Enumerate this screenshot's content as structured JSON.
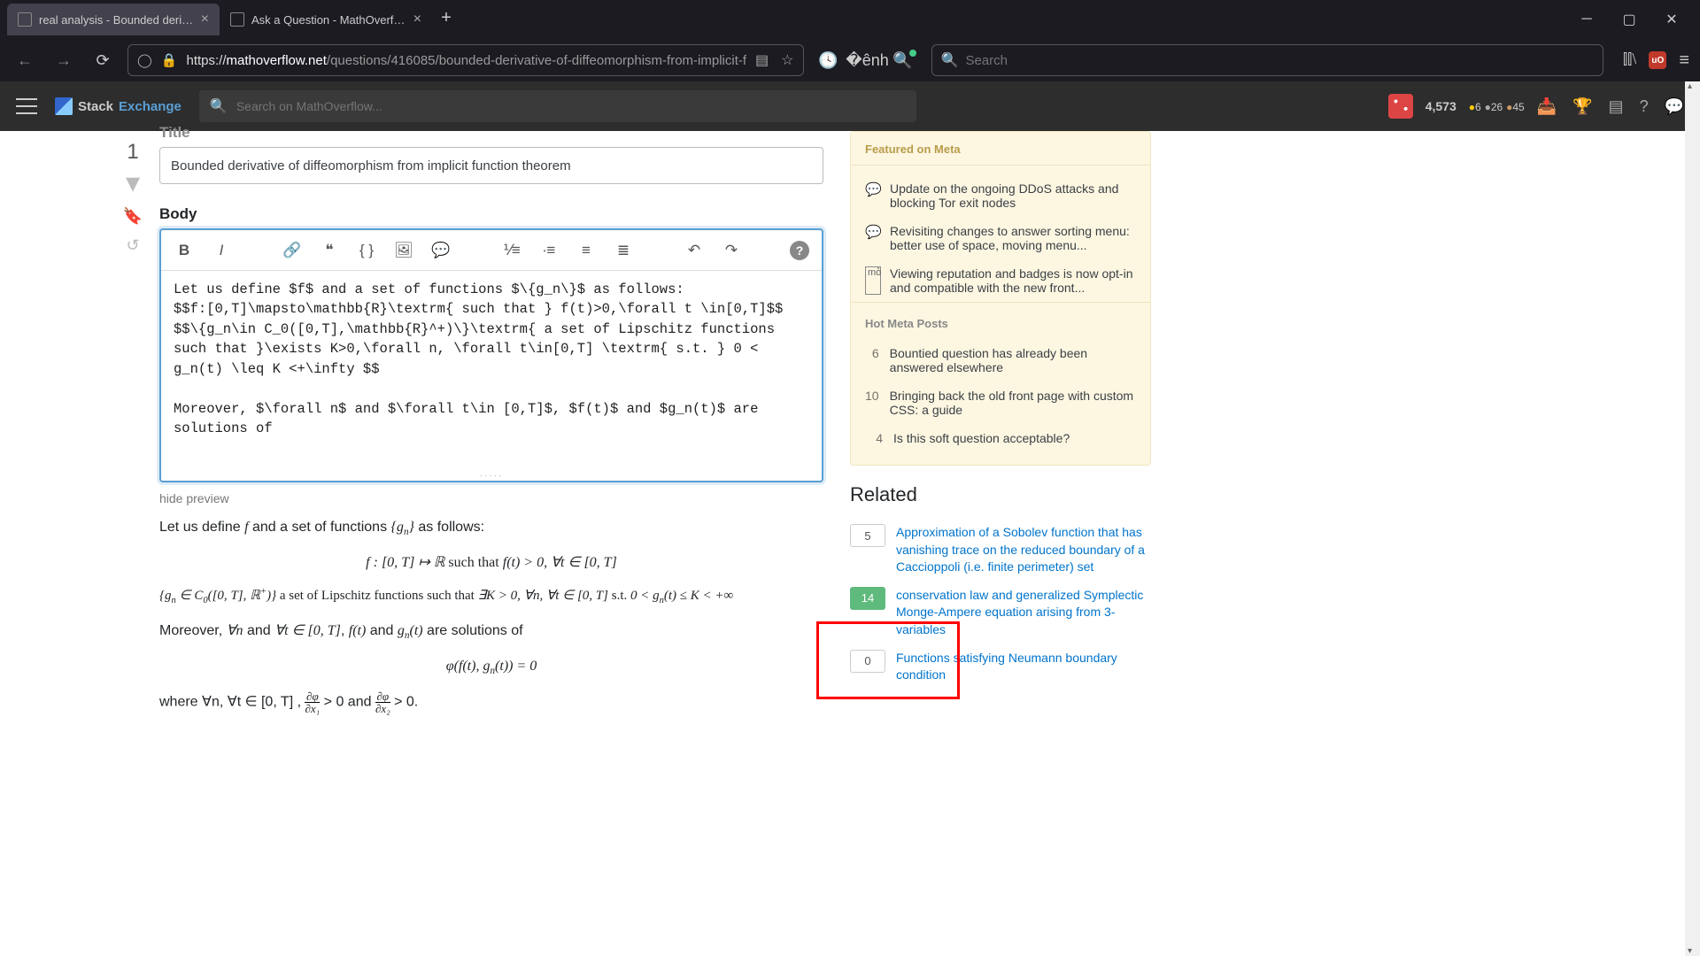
{
  "browser": {
    "tabs": [
      {
        "title": "real analysis - Bounded derivati",
        "active": true
      },
      {
        "title": "Ask a Question - MathOverflow",
        "active": false
      }
    ],
    "url_prefix": "https://",
    "url_domain": "mathoverflow.net",
    "url_path": "/questions/416085/bounded-derivative-of-diffeomorphism-from-implicit-f",
    "search_placeholder": "Search"
  },
  "topbar": {
    "logo_stack": "Stack",
    "logo_exchange": "Exchange",
    "search_placeholder": "Search on MathOverflow...",
    "rep": "4,573",
    "gold": "6",
    "silver": "26",
    "bronze": "45"
  },
  "editor": {
    "title_label": "Title",
    "title_value": "Bounded derivative of diffeomorphism from implicit function theorem",
    "body_label": "Body",
    "body_text": "Let us define $f$ and a set of functions $\\{g_n\\}$ as follows:\n$$f:[0,T]\\mapsto\\mathbb{R}\\textrm{ such that } f(t)>0,\\forall t \\in[0,T]$$\n$$\\{g_n\\in C_0([0,T],\\mathbb{R}^+)\\}\\textrm{ a set of Lipschitz functions such that }\\exists K>0,\\forall n, \\forall t\\in[0,T] \\textrm{ s.t. } 0 < g_n(t) \\leq K <+\\infty $$\n\nMoreover, $\\forall n$ and $\\forall t\\in [0,T]$, $f(t)$ and $g_n(t)$ are solutions of",
    "hide_preview": "hide preview",
    "grip": "·····"
  },
  "vote": {
    "score": "1"
  },
  "preview": {
    "p1_a": "Let us define ",
    "p1_b": " and a set of functions ",
    "p1_c": " as follows:",
    "disp1": "f : [0, T] ↦ ℝ such that f(t) > 0, ∀t ∈ [0, T]",
    "disp2": "{gₙ ∈ C₀([0, T], ℝ⁺)} a set of Lipschitz functions such that ∃K > 0, ∀n, ∀t ∈ [0, T] s.t. 0 < gₙ(t) ≤ K < +∞",
    "p2": "Moreover, ∀n and ∀t ∈ [0, T], f(t) and gₙ(t) are solutions of",
    "disp3": "φ(f(t), gₙ(t)) = 0",
    "p3_a": "where ∀n, ∀t ∈ [0, T] , ",
    "p3_frac1_top": "∂φ",
    "p3_frac1_bot": "∂x₁",
    "p3_mid": " > 0 and ",
    "p3_frac2_top": "∂φ",
    "p3_frac2_bot": "∂x₂",
    "p3_end": " > 0."
  },
  "meta": {
    "featured_head": "Featured on Meta",
    "items": [
      {
        "icon": "💬",
        "text": "Update on the ongoing DDoS attacks and blocking Tor exit nodes"
      },
      {
        "icon": "💬",
        "text": "Revisiting changes to answer sorting menu: better use of space, moving menu..."
      },
      {
        "icon": "mo͘",
        "text": "Viewing reputation and badges is now opt-in and compatible with the new front..."
      }
    ],
    "hot_head": "Hot Meta Posts",
    "hot": [
      {
        "n": "6",
        "text": "Bountied question has already been answered elsewhere"
      },
      {
        "n": "10",
        "text": "Bringing back the old front page with custom CSS: a guide"
      },
      {
        "n": "4",
        "text": "Is this soft question acceptable?"
      }
    ]
  },
  "related": {
    "head": "Related",
    "items": [
      {
        "n": "5",
        "answered": false,
        "text": "Approximation of a Sobolev function that has vanishing trace on the reduced boundary of a Caccioppoli (i.e. finite perimeter) set"
      },
      {
        "n": "14",
        "answered": true,
        "text": "conservation law and generalized Symplectic Monge-Ampere equation arising from 3-variables"
      },
      {
        "n": "0",
        "answered": false,
        "text": "Functions satisfying Neumann boundary condition"
      }
    ]
  }
}
